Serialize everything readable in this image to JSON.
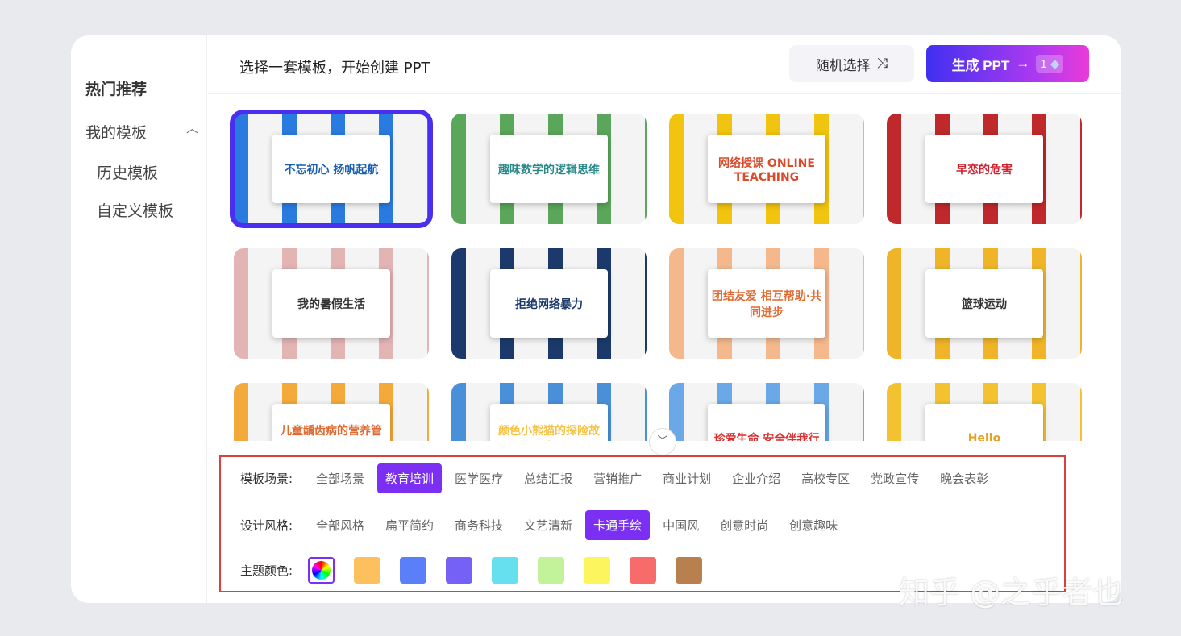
{
  "sidebar": {
    "hot": "热门推荐",
    "mine": "我的模板",
    "history": "历史模板",
    "custom": "自定义模板"
  },
  "header": {
    "title": "选择一套模板，开始创建 PPT",
    "random": "随机选择",
    "generate": "生成 PPT",
    "arrow": "→",
    "cost": "1"
  },
  "templates": [
    {
      "title": "不忘初心 扬帆起航",
      "bg": "#2a7be0",
      "fg": "#1a5fb4"
    },
    {
      "title": "趣味数学的逻辑思维",
      "bg": "#5aa65a",
      "fg": "#2a8a8a"
    },
    {
      "title": "网络授课 ONLINE TEACHING",
      "bg": "#f1c40f",
      "fg": "#d94b2b"
    },
    {
      "title": "早恋的危害",
      "bg": "#c0292b",
      "fg": "#d0202e"
    },
    {
      "title": "我的暑假生活",
      "bg": "#e3b4b4",
      "fg": "#333"
    },
    {
      "title": "拒绝网络暴力",
      "bg": "#1b3a6b",
      "fg": "#1b3a6b"
    },
    {
      "title": "团结友爱 相互帮助·共同进步",
      "bg": "#f5b88d",
      "fg": "#e06a30"
    },
    {
      "title": "篮球运动",
      "bg": "#f0b429",
      "fg": "#333"
    },
    {
      "title": "儿童龋齿病的营养管理",
      "bg": "#f4a93b",
      "fg": "#e06a30"
    },
    {
      "title": "颜色小熊猫的探险故事",
      "bg": "#4a90d9",
      "fg": "#f5c242"
    },
    {
      "title": "珍爱生命 安全伴我行",
      "bg": "#6aa8e8",
      "fg": "#d93030"
    },
    {
      "title": "Hello",
      "bg": "#f2c230",
      "fg": "#e8a020"
    }
  ],
  "filters": {
    "scene_label": "模板场景:",
    "scenes": [
      "全部场景",
      "教育培训",
      "医学医疗",
      "总结汇报",
      "营销推广",
      "商业计划",
      "企业介绍",
      "高校专区",
      "党政宣传",
      "晚会表彰"
    ],
    "scene_selected": 1,
    "style_label": "设计风格:",
    "styles": [
      "全部风格",
      "扁平简约",
      "商务科技",
      "文艺清新",
      "卡通手绘",
      "中国风",
      "创意时尚",
      "创意趣味"
    ],
    "style_selected": 4,
    "color_label": "主题颜色:",
    "colors": [
      "#fcc15c",
      "#5b7ff8",
      "#7561f6",
      "#66dfee",
      "#c2f39a",
      "#fcf55e",
      "#f86b6b",
      "#b9804f"
    ]
  },
  "watermark": "知乎 @之乎者也"
}
